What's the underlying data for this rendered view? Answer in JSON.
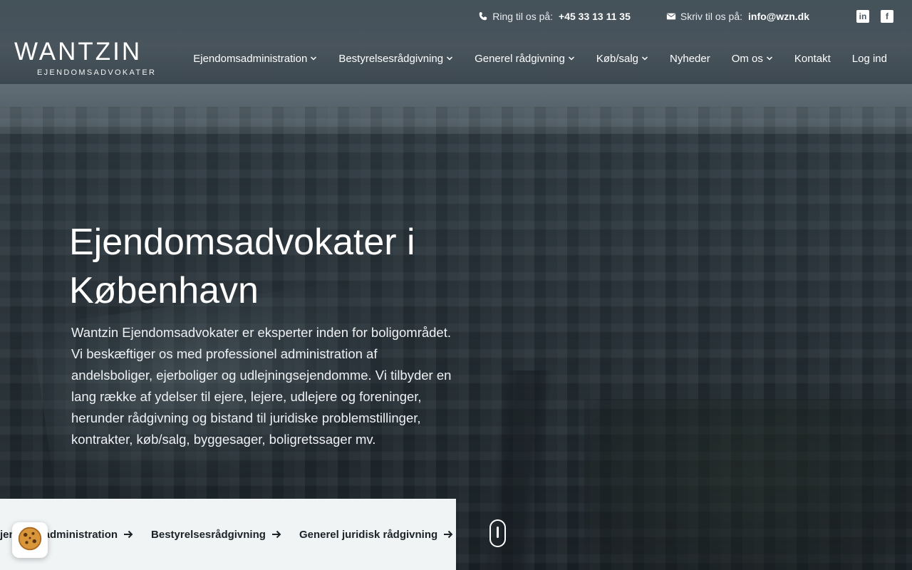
{
  "topbar": {
    "phone_label": "Ring til os på:",
    "phone_value": "+45 33 13 11 35",
    "email_label": "Skriv til os på:",
    "email_value": "info@wzn.dk",
    "social": [
      {
        "name": "linkedin-icon"
      },
      {
        "name": "facebook-icon"
      }
    ]
  },
  "logo": {
    "wordmark": "WANTZIN",
    "subtitle": "EJENDOMSADVOKATER"
  },
  "nav": {
    "items": [
      {
        "label": "Ejendomsadministration",
        "has_dropdown": true
      },
      {
        "label": "Bestyrelsesrådgivning",
        "has_dropdown": true
      },
      {
        "label": "Generel rådgivning",
        "has_dropdown": true
      },
      {
        "label": "Køb/salg",
        "has_dropdown": true
      },
      {
        "label": "Nyheder",
        "has_dropdown": false
      },
      {
        "label": "Om os",
        "has_dropdown": true
      },
      {
        "label": "Kontakt",
        "has_dropdown": false
      },
      {
        "label": "Log ind",
        "has_dropdown": false
      }
    ]
  },
  "hero": {
    "title": "Ejendomsadvokater i København",
    "text": "Wantzin Ejendomsadvokater er eksperter inden for boligområdet. Vi beskæftiger os med professionel administration af andelsboliger, ejerboliger og udlejningsejendomme. Vi tilbyder en lang række af ydelser til ejere, lejere, udlejere og foreninger, herunder rådgivning og bistand til juridiske problemstillinger, kontrakter, køb/salg, byggesager, boligretssager mv."
  },
  "quicklinks": {
    "items": [
      {
        "label": "Ejendomsadministration"
      },
      {
        "label": "Bestyrelsesrådgivning"
      },
      {
        "label": "Generel juridisk rådgivning"
      }
    ]
  },
  "colors": {
    "accent": "#1b2328",
    "quicklinks_bg": "#f0f4f5",
    "cookie": "#d9953a"
  }
}
